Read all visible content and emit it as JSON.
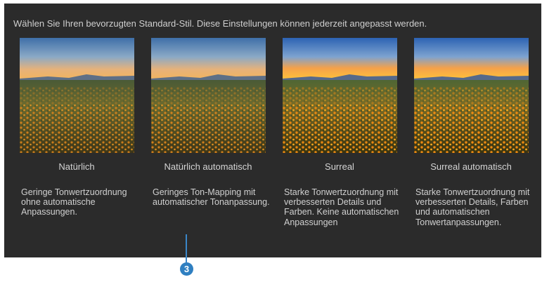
{
  "intro_text": "Wählen Sie Ihren bevorzugten Standard-Stil. Diese Einstellungen können jederzeit angepasst werden.",
  "styles": [
    {
      "name": "Natürlich",
      "description": "Geringe Tonwertzuordnung ohne automatische Anpassungen.",
      "look": "natural"
    },
    {
      "name": "Natürlich automatisch",
      "description": "Geringes Ton-Mapping mit automatischer Tonanpassung.",
      "look": "natural-auto"
    },
    {
      "name": "Surreal",
      "description": "Starke Tonwertzuordnung mit verbesserten Details und Farben. Keine automatischen Anpassungen",
      "look": "surreal"
    },
    {
      "name": "Surreal automatisch",
      "description": "Starke Tonwertzuordnung mit verbesserten Details, Farben und automatischen Tonwertanpassungen.",
      "look": "surreal-auto"
    }
  ],
  "callout": {
    "number": "3",
    "color": "#2f7fc1"
  }
}
